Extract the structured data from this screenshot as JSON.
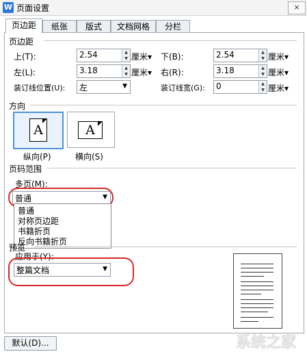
{
  "window": {
    "title": "页面设置",
    "close_glyph": "×"
  },
  "tabs": [
    {
      "label": "页边距",
      "active": true
    },
    {
      "label": "纸张",
      "active": false
    },
    {
      "label": "版式",
      "active": false
    },
    {
      "label": "文档网格",
      "active": false
    },
    {
      "label": "分栏",
      "active": false
    }
  ],
  "margins": {
    "section": "页边距",
    "top_label": "上(T):",
    "top_value": "2.54",
    "bottom_label": "下(B):",
    "bottom_value": "2.54",
    "left_label": "左(L):",
    "left_value": "3.18",
    "right_label": "右(R):",
    "right_value": "3.18",
    "gutter_pos_label": "装订线位置(U):",
    "gutter_pos_value": "左",
    "gutter_width_label": "装订线宽(G):",
    "gutter_width_value": "0",
    "unit": "厘米"
  },
  "orientation": {
    "section": "方向",
    "portrait_label": "纵向(P)",
    "landscape_label": "横向(S)",
    "icon_letter": "A"
  },
  "pages": {
    "section": "页码范围",
    "multi_label": "多页(M):",
    "multi_value": "普通",
    "options": [
      "普通",
      "对称页边距",
      "书籍折页",
      "反向书籍折页"
    ]
  },
  "preview": {
    "section": "预览",
    "apply_label": "应用于(Y):",
    "apply_value": "整篇文档"
  },
  "buttons": {
    "default_label": "默认(D)..."
  },
  "watermark": {
    "text": "系统之家"
  },
  "colors": {
    "highlight": "#d62828",
    "selected_border": "#4a90d9"
  }
}
